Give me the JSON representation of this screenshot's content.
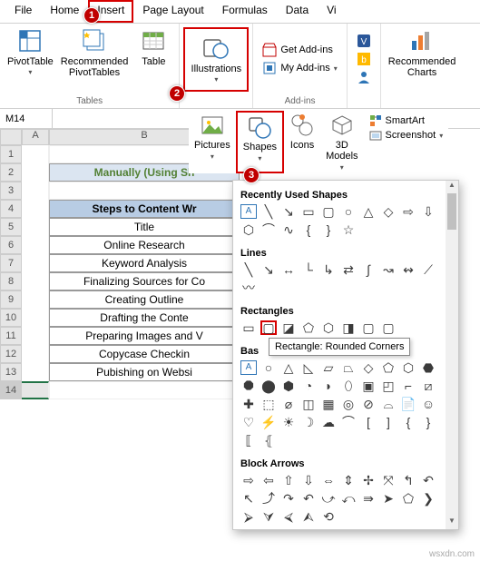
{
  "tabs": {
    "file": "File",
    "home": "Home",
    "insert": "Insert",
    "pagelayout": "Page Layout",
    "formulas": "Formulas",
    "data": "Data",
    "vi": "Vi"
  },
  "ribbon": {
    "tables": {
      "pivot": "PivotTable",
      "recpivot": "Recommended\nPivotTables",
      "table": "Table",
      "label": "Tables"
    },
    "illus": {
      "btn": "Illustrations"
    },
    "addins": {
      "get": "Get Add-ins",
      "my": "My Add-ins",
      "label": "Add-ins"
    },
    "charts": {
      "rec": "Recommended\nCharts"
    }
  },
  "sub": {
    "pictures": "Pictures",
    "shapes": "Shapes",
    "icons": "Icons",
    "models": "3D\nModels",
    "smartart": "SmartArt",
    "screenshot": "Screenshot"
  },
  "namebox": "M14",
  "cols": {
    "a": "A",
    "b": "B"
  },
  "cells": {
    "title": "Manually (Using Sh",
    "hdr": "Steps to Content Wr",
    "r5": "Title",
    "r6": "Online Research",
    "r7": "Keyword Analysis",
    "r8": "Finalizing Sources for Co",
    "r9": "Creating Outline",
    "r10": "Drafting the Conte",
    "r11": "Preparing Images and V",
    "r12": "Copycase Checkin",
    "r13": "Pubishing on Websi"
  },
  "dd": {
    "recent": "Recently Used Shapes",
    "lines": "Lines",
    "rects": "Rectangles",
    "basic": "Bas",
    "blockarrows": "Block Arrows",
    "tooltip": "Rectangle: Rounded Corners"
  },
  "watermark": "wsxdn.com"
}
